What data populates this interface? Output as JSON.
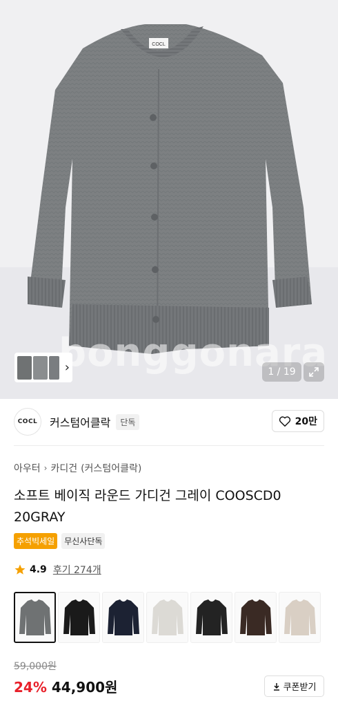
{
  "hero": {
    "watermark": "bonggonara",
    "image_counter": "1 / 19"
  },
  "brand": {
    "logo_text": "COCL",
    "name": "커스텀어클락",
    "tag": "단독",
    "likes": "20만"
  },
  "breadcrumb": [
    "아우터",
    "카디건",
    "(커스텀어클락)"
  ],
  "product": {
    "title": "소프트 베이직 라운드 가디건 그레이 COOSCD0 20GRAY",
    "badges": [
      "추석빅세일",
      "무신사단독"
    ],
    "rating": "4.9",
    "reviews": "후기 274개"
  },
  "swatches": [
    {
      "color": "#6f7273",
      "selected": true
    },
    {
      "color": "#1a1a1a",
      "selected": false
    },
    {
      "color": "#1c2233",
      "selected": false
    },
    {
      "color": "#dcdad5",
      "selected": false
    },
    {
      "color": "#232323",
      "selected": false
    },
    {
      "color": "#3a2a24",
      "selected": false
    },
    {
      "color": "#d9cfc4",
      "selected": false
    }
  ],
  "pricing": {
    "original": "59,000원",
    "discount": "24%",
    "price": "44,900원",
    "coupon_label": "쿠폰받기"
  },
  "colors": {
    "sweater": "#7d8082",
    "discount": "#e8202a",
    "sale_badge": "#f5a000",
    "star": "#f5a000"
  }
}
